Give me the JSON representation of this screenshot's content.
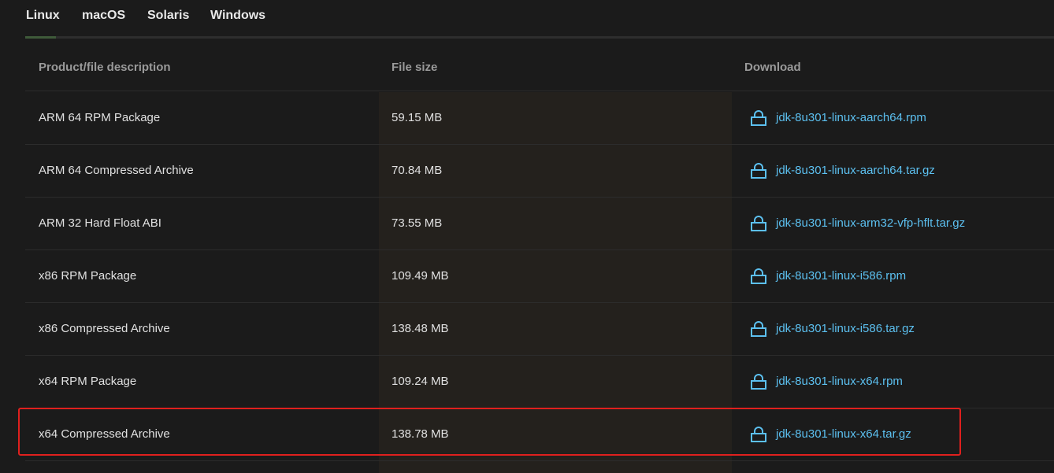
{
  "tabs": [
    {
      "label": "Linux",
      "active": true
    },
    {
      "label": "macOS",
      "active": false
    },
    {
      "label": "Solaris",
      "active": false
    },
    {
      "label": "Windows",
      "active": false
    }
  ],
  "table": {
    "headers": {
      "description": "Product/file description",
      "size": "File size",
      "download": "Download"
    },
    "rows": [
      {
        "description": "ARM 64 RPM Package",
        "size": "59.15 MB",
        "file": "jdk-8u301-linux-aarch64.rpm"
      },
      {
        "description": "ARM 64 Compressed Archive",
        "size": "70.84 MB",
        "file": "jdk-8u301-linux-aarch64.tar.gz"
      },
      {
        "description": "ARM 32 Hard Float ABI",
        "size": "73.55 MB",
        "file": "jdk-8u301-linux-arm32-vfp-hflt.tar.gz"
      },
      {
        "description": "x86 RPM Package",
        "size": "109.49 MB",
        "file": "jdk-8u301-linux-i586.rpm"
      },
      {
        "description": "x86 Compressed Archive",
        "size": "138.48 MB",
        "file": "jdk-8u301-linux-i586.tar.gz"
      },
      {
        "description": "x64 RPM Package",
        "size": "109.24 MB",
        "file": "jdk-8u301-linux-x64.rpm"
      },
      {
        "description": "x64 Compressed Archive",
        "size": "138.78 MB",
        "file": "jdk-8u301-linux-x64.tar.gz",
        "highlighted": true
      }
    ]
  },
  "icons": {
    "download": "lock-icon"
  },
  "colors": {
    "background": "#1b1b1b",
    "link": "#5cc0f0",
    "highlight_border": "#e0201e",
    "size_column_shade": "#24211d"
  }
}
